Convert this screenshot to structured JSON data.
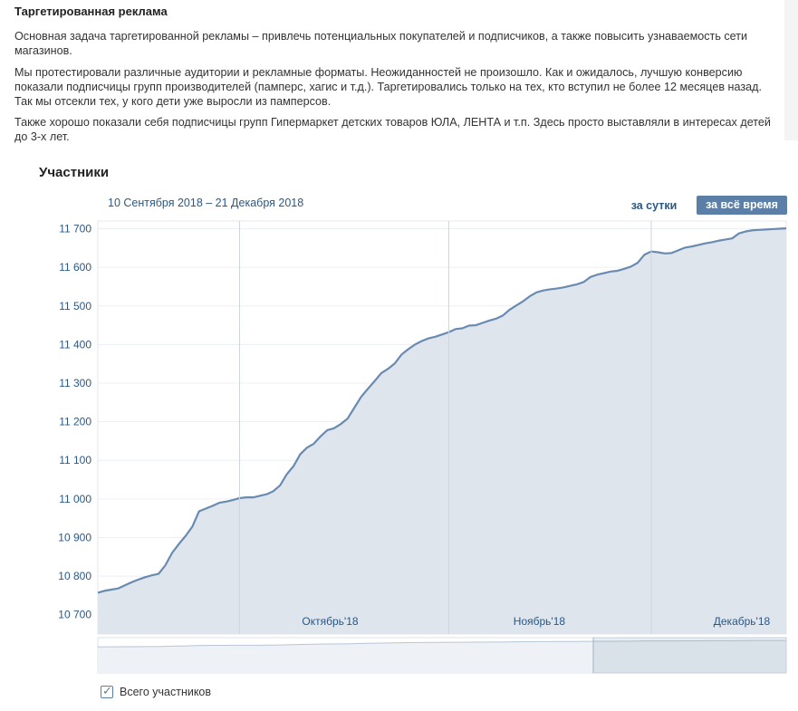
{
  "article": {
    "heading": "Таргетированная реклама",
    "p1": "Основная задача таргетированной рекламы – привлечь потенциальных покупателей и подписчиков, а также повысить узнаваемость сети магазинов.",
    "p2": "Мы протестировали различные аудитории и рекламные форматы. Неожиданностей не произошло. Как и ожидалось, лучшую конверсию показали подписчицы групп производителей (памперс, хагис и т.д.). Таргетировались только на тех, кто вступил не более 12 месяцев назад. Так мы отсекли тех, у кого дети уже выросли из памперсов.",
    "p3": "Также хорошо показали себя подписчицы групп Гипермаркет детских товаров ЮЛА, ЛЕНТА и т.п. Здесь просто выставляли в интересах детей до 3-х лет."
  },
  "section_title": "Участники",
  "date_range": "10 Сентября 2018 – 21 Декабря 2018",
  "buttons": {
    "day": "за сутки",
    "all_time": "за всё время"
  },
  "legend": {
    "label": "Всего участников",
    "checked": true
  },
  "colors": {
    "line": "#6a8bb0",
    "area": "#dfe5ed",
    "active_button": "#5b7fa6",
    "link": "#2a5885"
  },
  "chart_data": {
    "type": "area",
    "title": "",
    "xlabel": "",
    "ylabel": "",
    "x_range": [
      "2018-09-10",
      "2018-12-21"
    ],
    "ylim": [
      10650,
      11720
    ],
    "yticks": [
      10700,
      10800,
      10900,
      11000,
      11100,
      11200,
      11300,
      11400,
      11500,
      11600,
      11700
    ],
    "ytick_labels": [
      "10 700",
      "10 800",
      "10 900",
      "11 000",
      "11 100",
      "11 200",
      "11 300",
      "11 400",
      "11 500",
      "11 600",
      "11 700"
    ],
    "xticks": [
      {
        "date": "2018-10-01",
        "label": "Октябрь'18"
      },
      {
        "date": "2018-11-01",
        "label": "Ноябрь'18"
      },
      {
        "date": "2018-12-01",
        "label": "Декабрь'18"
      }
    ],
    "grid": true,
    "series": [
      {
        "name": "Всего участников",
        "x": [
          "2018-09-10",
          "2018-09-11",
          "2018-09-12",
          "2018-09-13",
          "2018-09-14",
          "2018-09-15",
          "2018-09-16",
          "2018-09-17",
          "2018-09-18",
          "2018-09-19",
          "2018-09-20",
          "2018-09-21",
          "2018-09-22",
          "2018-09-23",
          "2018-09-24",
          "2018-09-25",
          "2018-09-26",
          "2018-09-27",
          "2018-09-28",
          "2018-09-29",
          "2018-09-30",
          "2018-10-01",
          "2018-10-02",
          "2018-10-03",
          "2018-10-04",
          "2018-10-05",
          "2018-10-06",
          "2018-10-07",
          "2018-10-08",
          "2018-10-09",
          "2018-10-10",
          "2018-10-11",
          "2018-10-12",
          "2018-10-13",
          "2018-10-14",
          "2018-10-15",
          "2018-10-16",
          "2018-10-17",
          "2018-10-18",
          "2018-10-19",
          "2018-10-20",
          "2018-10-21",
          "2018-10-22",
          "2018-10-23",
          "2018-10-24",
          "2018-10-25",
          "2018-10-26",
          "2018-10-27",
          "2018-10-28",
          "2018-10-29",
          "2018-10-30",
          "2018-10-31",
          "2018-11-01",
          "2018-11-02",
          "2018-11-03",
          "2018-11-04",
          "2018-11-05",
          "2018-11-06",
          "2018-11-07",
          "2018-11-08",
          "2018-11-09",
          "2018-11-10",
          "2018-11-11",
          "2018-11-12",
          "2018-11-13",
          "2018-11-14",
          "2018-11-15",
          "2018-11-16",
          "2018-11-17",
          "2018-11-18",
          "2018-11-19",
          "2018-11-20",
          "2018-11-21",
          "2018-11-22",
          "2018-11-23",
          "2018-11-24",
          "2018-11-25",
          "2018-11-26",
          "2018-11-27",
          "2018-11-28",
          "2018-11-29",
          "2018-11-30",
          "2018-12-01",
          "2018-12-02",
          "2018-12-03",
          "2018-12-04",
          "2018-12-05",
          "2018-12-06",
          "2018-12-07",
          "2018-12-08",
          "2018-12-09",
          "2018-12-10",
          "2018-12-11",
          "2018-12-12",
          "2018-12-13",
          "2018-12-14",
          "2018-12-15",
          "2018-12-16",
          "2018-12-17",
          "2018-12-18",
          "2018-12-19",
          "2018-12-20",
          "2018-12-21"
        ],
        "values": [
          10757,
          10762,
          10765,
          10768,
          10776,
          10784,
          10791,
          10797,
          10802,
          10806,
          10828,
          10860,
          10883,
          10904,
          10928,
          10968,
          10975,
          10982,
          10990,
          10993,
          10997,
          11002,
          11004,
          11004,
          11008,
          11012,
          11020,
          11035,
          11064,
          11085,
          11116,
          11133,
          11143,
          11162,
          11178,
          11183,
          11194,
          11208,
          11236,
          11264,
          11285,
          11305,
          11326,
          11337,
          11351,
          11374,
          11388,
          11400,
          11409,
          11416,
          11420,
          11426,
          11432,
          11440,
          11442,
          11449,
          11450,
          11456,
          11462,
          11467,
          11475,
          11490,
          11501,
          11512,
          11525,
          11535,
          11540,
          11543,
          11545,
          11548,
          11552,
          11556,
          11562,
          11575,
          11581,
          11585,
          11589,
          11591,
          11596,
          11602,
          11612,
          11633,
          11641,
          11639,
          11636,
          11637,
          11644,
          11651,
          11654,
          11658,
          11662,
          11665,
          11669,
          11672,
          11675,
          11688,
          11693,
          11696,
          11697,
          11698,
          11699,
          11700,
          11701
        ]
      }
    ]
  }
}
